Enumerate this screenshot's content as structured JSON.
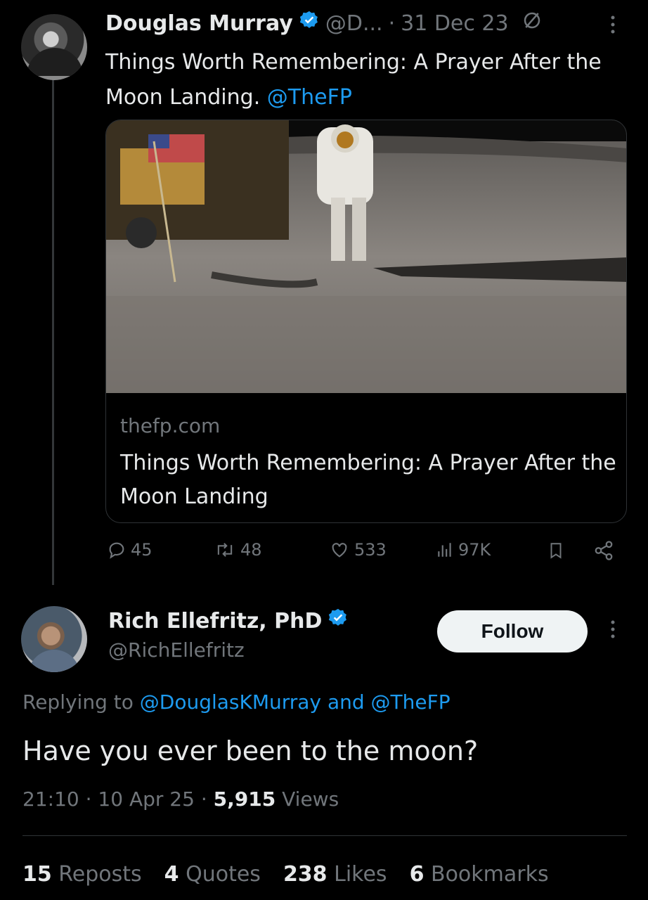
{
  "tweet": {
    "author_name": "Douglas Murray",
    "author_handle": "@D...",
    "date": "31 Dec 23",
    "text": "Things Worth Remembering: A Prayer After the Moon Landing.",
    "mention": "@TheFP",
    "card": {
      "domain": "thefp.com",
      "title": "Things Worth Remembering: A Prayer After the Moon Landing"
    },
    "stats": {
      "replies": "45",
      "reposts": "48",
      "likes": "533",
      "views": "97K"
    }
  },
  "reply": {
    "author_name": "Rich Ellefritz, PhD",
    "author_handle": "@RichEllefritz",
    "follow_label": "Follow",
    "replying_prefix": "Replying to",
    "replying_user1": "@DouglasKMurray",
    "replying_and": "and",
    "replying_user2": "@TheFP",
    "text": "Have you ever been to the moon?",
    "time": "21:10",
    "date": "10 Apr 25",
    "views_count": "5,915",
    "views_label": "Views",
    "reposts_count": "15",
    "reposts_label": "Reposts",
    "quotes_count": "4",
    "quotes_label": "Quotes",
    "likes_count": "238",
    "likes_label": "Likes",
    "bookmarks_count": "6",
    "bookmarks_label": "Bookmarks"
  },
  "separator": "·",
  "colors": {
    "background": "#000000",
    "text": "#e7e9ea",
    "muted": "#71767b",
    "accent": "#1d9bf0",
    "border": "#2f3336"
  },
  "icons": [
    "verified-badge-icon",
    "grok-icon",
    "more-icon",
    "reply-icon",
    "repost-icon",
    "like-icon",
    "views-icon",
    "bookmark-icon",
    "share-icon"
  ]
}
